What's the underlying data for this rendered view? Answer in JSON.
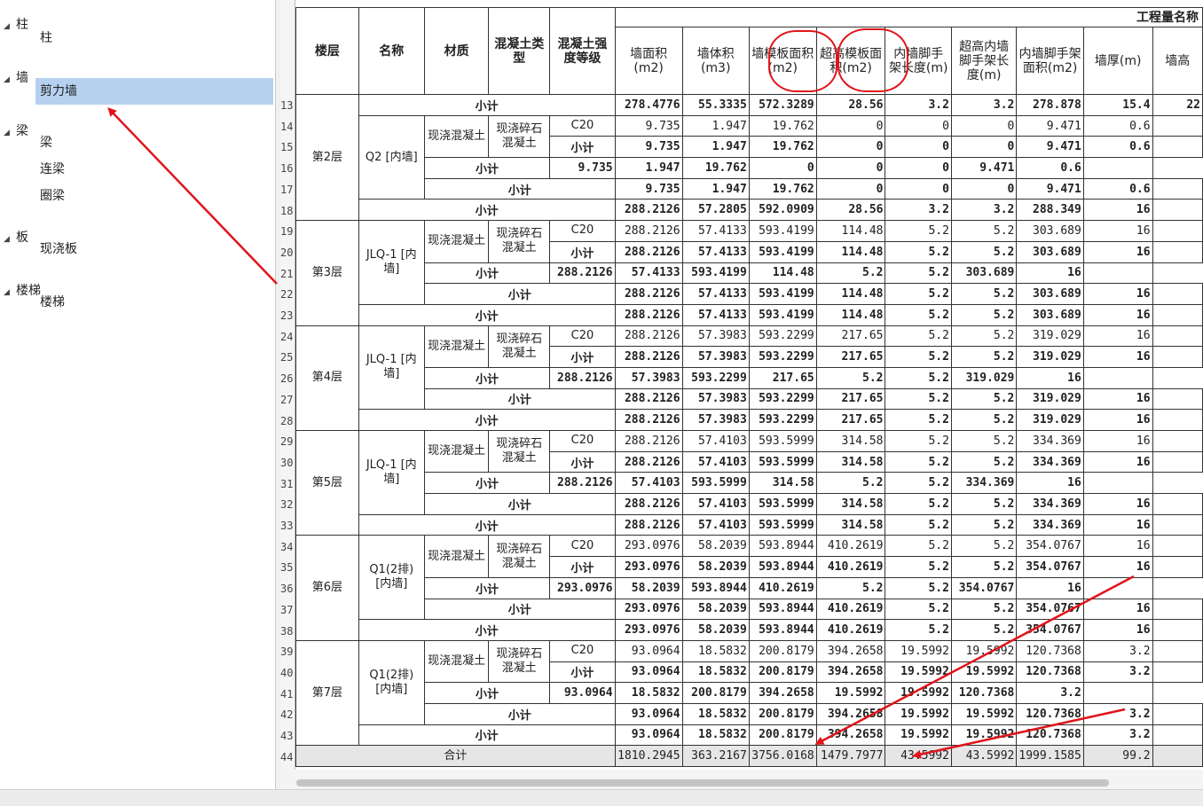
{
  "tree": [
    {
      "label": "柱",
      "children": [
        "柱"
      ]
    },
    {
      "label": "墙",
      "children": [
        "剪力墙"
      ]
    },
    {
      "label": "梁",
      "children": [
        "梁",
        "连梁",
        "圈梁"
      ]
    },
    {
      "label": "板",
      "children": [
        "现浇板"
      ]
    },
    {
      "label": "楼梯",
      "children": [
        "楼梯"
      ]
    }
  ],
  "selected_item": "剪力墙",
  "sheet": {
    "group_header": "工程量名称",
    "headers": [
      "楼层",
      "名称",
      "材质",
      "混凝土类型",
      "混凝土强度等级",
      "墙面积(m2)",
      "墙体积(m3)",
      "墙模板面积(m2)",
      "超高模板面积(m2)",
      "内墙脚手架长度(m)",
      "超高内墙脚手架长度(m)",
      "内墙脚手架面积(m2)",
      "墙厚(m)",
      "墙高"
    ],
    "rows": [
      {
        "n": "13",
        "kind": "sub3",
        "label": "小计",
        "v": [
          "278.4776",
          "55.3335",
          "572.3289",
          "28.56",
          "3.2",
          "3.2",
          "278.878",
          "15.4",
          "22"
        ]
      },
      {
        "n": "14",
        "kind": "data",
        "grade": "C20",
        "v": [
          "9.735",
          "1.947",
          "19.762",
          "0",
          "0",
          "0",
          "9.471",
          "0.6",
          ""
        ]
      },
      {
        "n": "15",
        "kind": "sub5",
        "label": "小计",
        "v": [
          "9.735",
          "1.947",
          "19.762",
          "0",
          "0",
          "0",
          "9.471",
          "0.6",
          ""
        ]
      },
      {
        "n": "16",
        "kind": "sub4",
        "label": "小计",
        "v": [
          "9.735",
          "1.947",
          "19.762",
          "0",
          "0",
          "0",
          "9.471",
          "0.6",
          ""
        ]
      },
      {
        "n": "17",
        "kind": "sub3",
        "label": "小计",
        "v": [
          "9.735",
          "1.947",
          "19.762",
          "0",
          "0",
          "0",
          "9.471",
          "0.6",
          ""
        ]
      },
      {
        "n": "18",
        "kind": "sub2",
        "label": "小计",
        "v": [
          "288.2126",
          "57.2805",
          "592.0909",
          "28.56",
          "3.2",
          "3.2",
          "288.349",
          "16",
          ""
        ]
      },
      {
        "n": "19",
        "kind": "data",
        "grade": "C20",
        "v": [
          "288.2126",
          "57.4133",
          "593.4199",
          "114.48",
          "5.2",
          "5.2",
          "303.689",
          "16",
          ""
        ]
      },
      {
        "n": "20",
        "kind": "sub5",
        "label": "小计",
        "v": [
          "288.2126",
          "57.4133",
          "593.4199",
          "114.48",
          "5.2",
          "5.2",
          "303.689",
          "16",
          ""
        ]
      },
      {
        "n": "21",
        "kind": "sub4",
        "label": "小计",
        "v": [
          "288.2126",
          "57.4133",
          "593.4199",
          "114.48",
          "5.2",
          "5.2",
          "303.689",
          "16",
          ""
        ]
      },
      {
        "n": "22",
        "kind": "sub3",
        "label": "小计",
        "v": [
          "288.2126",
          "57.4133",
          "593.4199",
          "114.48",
          "5.2",
          "5.2",
          "303.689",
          "16",
          ""
        ]
      },
      {
        "n": "23",
        "kind": "sub2",
        "label": "小计",
        "v": [
          "288.2126",
          "57.4133",
          "593.4199",
          "114.48",
          "5.2",
          "5.2",
          "303.689",
          "16",
          ""
        ]
      },
      {
        "n": "24",
        "kind": "data",
        "grade": "C20",
        "v": [
          "288.2126",
          "57.3983",
          "593.2299",
          "217.65",
          "5.2",
          "5.2",
          "319.029",
          "16",
          ""
        ]
      },
      {
        "n": "25",
        "kind": "sub5",
        "label": "小计",
        "v": [
          "288.2126",
          "57.3983",
          "593.2299",
          "217.65",
          "5.2",
          "5.2",
          "319.029",
          "16",
          ""
        ]
      },
      {
        "n": "26",
        "kind": "sub4",
        "label": "小计",
        "v": [
          "288.2126",
          "57.3983",
          "593.2299",
          "217.65",
          "5.2",
          "5.2",
          "319.029",
          "16",
          ""
        ]
      },
      {
        "n": "27",
        "kind": "sub3",
        "label": "小计",
        "v": [
          "288.2126",
          "57.3983",
          "593.2299",
          "217.65",
          "5.2",
          "5.2",
          "319.029",
          "16",
          ""
        ]
      },
      {
        "n": "28",
        "kind": "sub2",
        "label": "小计",
        "v": [
          "288.2126",
          "57.3983",
          "593.2299",
          "217.65",
          "5.2",
          "5.2",
          "319.029",
          "16",
          ""
        ]
      },
      {
        "n": "29",
        "kind": "data",
        "grade": "C20",
        "v": [
          "288.2126",
          "57.4103",
          "593.5999",
          "314.58",
          "5.2",
          "5.2",
          "334.369",
          "16",
          ""
        ]
      },
      {
        "n": "30",
        "kind": "sub5",
        "label": "小计",
        "v": [
          "288.2126",
          "57.4103",
          "593.5999",
          "314.58",
          "5.2",
          "5.2",
          "334.369",
          "16",
          ""
        ]
      },
      {
        "n": "31",
        "kind": "sub4",
        "label": "小计",
        "v": [
          "288.2126",
          "57.4103",
          "593.5999",
          "314.58",
          "5.2",
          "5.2",
          "334.369",
          "16",
          ""
        ]
      },
      {
        "n": "32",
        "kind": "sub3",
        "label": "小计",
        "v": [
          "288.2126",
          "57.4103",
          "593.5999",
          "314.58",
          "5.2",
          "5.2",
          "334.369",
          "16",
          ""
        ]
      },
      {
        "n": "33",
        "kind": "sub2",
        "label": "小计",
        "v": [
          "288.2126",
          "57.4103",
          "593.5999",
          "314.58",
          "5.2",
          "5.2",
          "334.369",
          "16",
          ""
        ]
      },
      {
        "n": "34",
        "kind": "data",
        "grade": "C20",
        "v": [
          "293.0976",
          "58.2039",
          "593.8944",
          "410.2619",
          "5.2",
          "5.2",
          "354.0767",
          "16",
          ""
        ]
      },
      {
        "n": "35",
        "kind": "sub5",
        "label": "小计",
        "v": [
          "293.0976",
          "58.2039",
          "593.8944",
          "410.2619",
          "5.2",
          "5.2",
          "354.0767",
          "16",
          ""
        ]
      },
      {
        "n": "36",
        "kind": "sub4",
        "label": "小计",
        "v": [
          "293.0976",
          "58.2039",
          "593.8944",
          "410.2619",
          "5.2",
          "5.2",
          "354.0767",
          "16",
          ""
        ]
      },
      {
        "n": "37",
        "kind": "sub3",
        "label": "小计",
        "v": [
          "293.0976",
          "58.2039",
          "593.8944",
          "410.2619",
          "5.2",
          "5.2",
          "354.0767",
          "16",
          ""
        ]
      },
      {
        "n": "38",
        "kind": "sub2",
        "label": "小计",
        "v": [
          "293.0976",
          "58.2039",
          "593.8944",
          "410.2619",
          "5.2",
          "5.2",
          "354.0767",
          "16",
          ""
        ]
      },
      {
        "n": "39",
        "kind": "data",
        "grade": "C20",
        "v": [
          "93.0964",
          "18.5832",
          "200.8179",
          "394.2658",
          "19.5992",
          "19.5992",
          "120.7368",
          "3.2",
          ""
        ]
      },
      {
        "n": "40",
        "kind": "sub5",
        "label": "小计",
        "v": [
          "93.0964",
          "18.5832",
          "200.8179",
          "394.2658",
          "19.5992",
          "19.5992",
          "120.7368",
          "3.2",
          ""
        ]
      },
      {
        "n": "41",
        "kind": "sub4",
        "label": "小计",
        "v": [
          "93.0964",
          "18.5832",
          "200.8179",
          "394.2658",
          "19.5992",
          "19.5992",
          "120.7368",
          "3.2",
          ""
        ]
      },
      {
        "n": "42",
        "kind": "sub3",
        "label": "小计",
        "v": [
          "93.0964",
          "18.5832",
          "200.8179",
          "394.2658",
          "19.5992",
          "19.5992",
          "120.7368",
          "3.2",
          ""
        ]
      },
      {
        "n": "43",
        "kind": "sub2",
        "label": "小计",
        "v": [
          "93.0964",
          "18.5832",
          "200.8179",
          "394.2658",
          "19.5992",
          "19.5992",
          "120.7368",
          "3.2",
          ""
        ]
      },
      {
        "n": "44",
        "kind": "total",
        "label": "合计",
        "v": [
          "1810.2945",
          "363.2167",
          "3756.0168",
          "1479.7977",
          "43.5992",
          "43.5992",
          "1999.1585",
          "99.2",
          ""
        ]
      }
    ],
    "floors": [
      {
        "label": "第2层",
        "start": "13",
        "span": 6
      },
      {
        "label": "第3层",
        "start": "19",
        "span": 5
      },
      {
        "label": "第4层",
        "start": "24",
        "span": 5
      },
      {
        "label": "第5层",
        "start": "29",
        "span": 5
      },
      {
        "label": "第6层",
        "start": "34",
        "span": 5
      },
      {
        "label": "第7层",
        "start": "39",
        "span": 5
      }
    ],
    "names": [
      {
        "label": "Q2 [内墙]",
        "start": "14",
        "span": 4
      },
      {
        "label": "JLQ-1 [内墙]",
        "start": "19",
        "span": 4
      },
      {
        "label": "JLQ-1 [内墙]",
        "start": "24",
        "span": 4
      },
      {
        "label": "JLQ-1 [内墙]",
        "start": "29",
        "span": 4
      },
      {
        "label": "Q1(2排) [内墙]",
        "start": "34",
        "span": 4
      },
      {
        "label": "Q1(2排) [内墙]",
        "start": "39",
        "span": 4
      }
    ],
    "material": "现浇混凝土",
    "concrete_type": "现浇碎石混凝土"
  },
  "accent_colors": {
    "selection": "#b6d1ef",
    "annotation": "#e0141b",
    "total_row": "#e6e6e6"
  }
}
